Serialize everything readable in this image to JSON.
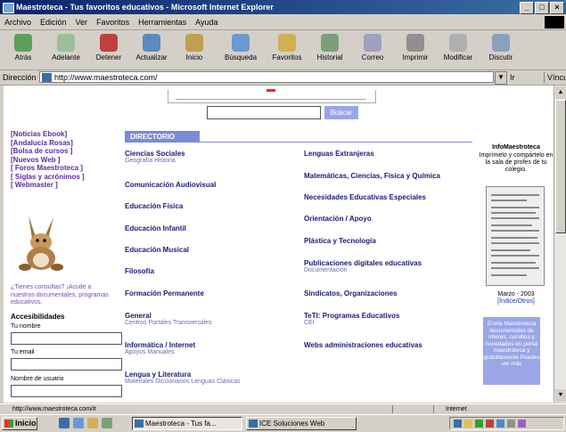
{
  "window": {
    "title": "Maestroteca - Tus favoritos educativos - Microsoft Internet Explorer",
    "controls": [
      "_",
      "□",
      "×"
    ]
  },
  "menu": [
    "Archivo",
    "Edición",
    "Ver",
    "Favoritos",
    "Herramientas",
    "Ayuda"
  ],
  "toolbar": [
    "Atrás",
    "Adelante",
    "Detener",
    "Actualizar",
    "Inicio",
    "Búsqueda",
    "Favoritos",
    "Historial",
    "Correo",
    "Imprimir",
    "Modificar",
    "Discutir"
  ],
  "address": {
    "label": "Dirección",
    "url": "http://www.maestroteca.com/",
    "go": "Ir",
    "links": "Vínculos"
  },
  "search": {
    "button": "Buscar"
  },
  "nav_links": [
    "[Noticias Ebook]",
    "[Andalucía Rosas]",
    "[Bolsa de cursos ]",
    "[Nuevos Web ]",
    "[ Foros Maestroteca ]",
    "[ Siglas y acrónimos ]",
    "[ Webmaster ]"
  ],
  "forum_text": "¿Tienes consultas? ¡Acude a nuestros documentales, programas educativos.",
  "register": {
    "title": "Accesibilidades",
    "name_label": "Tu nombre",
    "email_label": "Tu email",
    "third_label": "Nombre de usuario"
  },
  "directory": {
    "heading": "DIRECTORIO",
    "left": [
      {
        "title": "Ciencias Sociales",
        "sub": "Geografía Historia"
      },
      {
        "title": "Comunicación Audiovisual"
      },
      {
        "title": "Educación Física"
      },
      {
        "title": "Educación Infantil"
      },
      {
        "title": "Educación Musical"
      },
      {
        "title": "Filosofía"
      },
      {
        "title": "Formación Permanente"
      },
      {
        "title": "General",
        "sub": "Centros Portales Transversales"
      },
      {
        "title": "Informática / Internet",
        "sub": "Apoyos Manuales"
      },
      {
        "title": "Lengua y Literatura",
        "sub": "Materiales Diccionarios Lenguas Clásicas"
      }
    ],
    "right": [
      {
        "title": "Lenguas Extranjeras"
      },
      {
        "title": "Matemáticas, Ciencias, Física y Química"
      },
      {
        "title": "Necesidades Educativas Especiales"
      },
      {
        "title": "Orientación / Apoyo"
      },
      {
        "title": "Plástica y Tecnología"
      },
      {
        "title": "Publicaciones digitales educativas",
        "sub": "Documentación"
      },
      {
        "title": "Sindicatos, Organizaciones"
      },
      {
        "title": "TeTI: Programas Educativos",
        "sub": "CEI"
      },
      {
        "title": "Webs administraciones educativas"
      }
    ]
  },
  "sidebar_right": {
    "title": "InfoMaestroteca",
    "desc": "Imprímelo y compártelo en la sala de profes de tu colegio.",
    "date": "Marzo - 2003",
    "link": "[Índice/Otros]",
    "promo": "Envía Maestroteca documentales de interés, cursillos y novedades en portal maestroteca y gratuitamente Puedes ver más"
  },
  "status": {
    "left": "http://www.maestroteca.com/#",
    "zone": "Internet"
  },
  "taskbar": {
    "start": "Inicio",
    "tasks": [
      {
        "label": "Maestroteca - Tus fa..."
      },
      {
        "label": "ICE Soluciones Web"
      }
    ]
  }
}
